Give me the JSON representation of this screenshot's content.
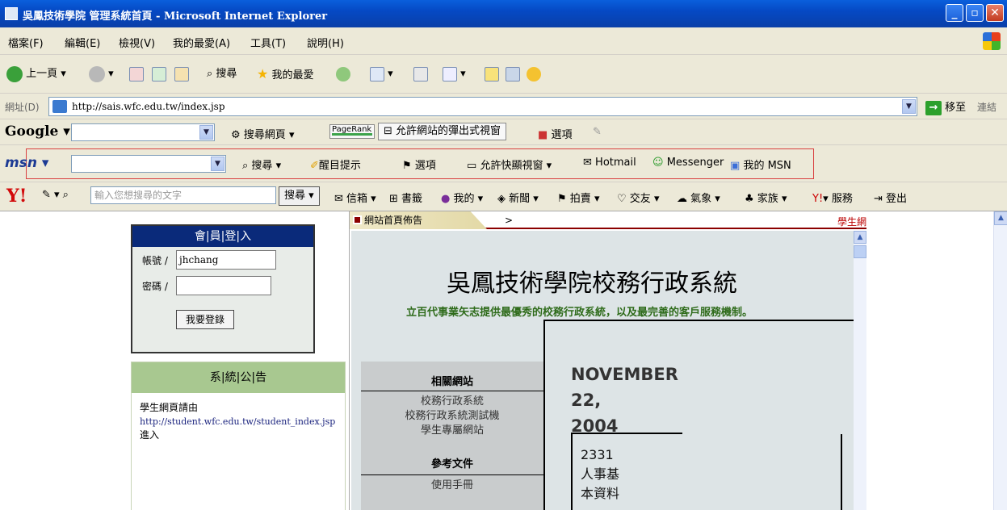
{
  "window": {
    "title": "吳鳳技術學院 管理系統首頁 - Microsoft Internet Explorer",
    "buttons": [
      "_",
      "▫",
      "✕"
    ]
  },
  "menu": [
    "檔案(F)",
    "編輯(E)",
    "檢視(V)",
    "我的最愛(A)",
    "工具(T)",
    "說明(H)"
  ],
  "toolbar": {
    "back_label": "上一頁",
    "search_label": "搜尋",
    "favorites_label": "我的最愛"
  },
  "address": {
    "label": "網址(D)",
    "url": "http://sais.wfc.edu.tw/index.jsp",
    "go_label": "移至",
    "links_label": "連結"
  },
  "google": {
    "logo": "Google",
    "search_web": "搜尋網頁",
    "pagerank": "PageRank",
    "popup": "允許網站的彈出式視窗",
    "options": "選項"
  },
  "msn": {
    "logo": "msn",
    "search": "搜尋",
    "highlight": "醒目提示",
    "options": "選項",
    "popup": "允許快顯視窗",
    "hotmail": "Hotmail",
    "messenger": "Messenger",
    "my_msn": "我的 MSN"
  },
  "yahoo": {
    "logo": "Y!",
    "placeholder": "輸入您想搜尋的文字",
    "search_btn": "搜尋",
    "items": [
      "信箱",
      "書籤",
      "我的",
      "新聞",
      "拍賣",
      "交友",
      "氣象",
      "家族",
      "服務",
      "登出"
    ]
  },
  "login": {
    "header": "會|員|登|入",
    "account_label": "帳號 /",
    "account_value": "jhchang",
    "password_label": "密碼 /",
    "password_value": "",
    "submit": "我要登錄"
  },
  "notice": {
    "header": "系|統|公|告",
    "line1": "學生網頁請由",
    "link": "http://student.wfc.edu.tw/student_index.jsp",
    "line3": "進入"
  },
  "panel": {
    "tab_label": "網站首頁佈告",
    "tab_arrow": ">",
    "tab_right": "學生網",
    "title": "吳鳳技術學院校務行政系統",
    "slogan": "立百代事業矢志提供最優秀的校務行政系統，以及最完善的客戶服務機制。",
    "related_head": "相關網站",
    "related_links": [
      "校務行政系統",
      "校務行政系統測試機",
      "學生專屬網站"
    ],
    "docs_head": "參考文件",
    "docs_links": [
      "使用手冊"
    ],
    "date_month": "NOVEMBER",
    "date_day": "22,",
    "date_year": "2004",
    "box_lines": [
      "2331",
      "人事基",
      "本資料"
    ]
  }
}
